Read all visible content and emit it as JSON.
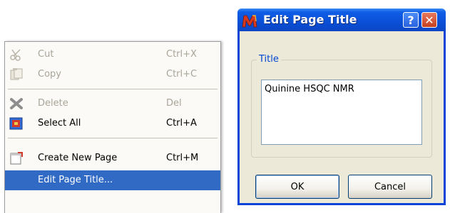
{
  "menu": {
    "items": [
      {
        "label": "Cut",
        "shortcut": "Ctrl+X",
        "icon": "scissors-icon",
        "enabled": false
      },
      {
        "label": "Copy",
        "shortcut": "Ctrl+C",
        "icon": "copy-icon",
        "enabled": false
      },
      {
        "label": "Delete",
        "shortcut": "Del",
        "icon": "delete-x-icon",
        "enabled": false
      },
      {
        "label": "Select All",
        "shortcut": "Ctrl+A",
        "icon": "select-all-icon",
        "enabled": true
      },
      {
        "label": "Create New Page",
        "shortcut": "Ctrl+M",
        "icon": "new-page-icon",
        "enabled": true
      },
      {
        "label": "Edit Page Title...",
        "shortcut": "",
        "icon": "",
        "enabled": true,
        "highlighted": true
      }
    ]
  },
  "dialog": {
    "title": "Edit Page Title",
    "help_label": "?",
    "close_label": "✕",
    "group_label": "Title",
    "title_value": "Quinine HSQC NMR",
    "ok_label": "OK",
    "cancel_label": "Cancel"
  },
  "colors": {
    "titlebar": "#0a4fd6",
    "highlight": "#316ac5",
    "group_label": "#0046d5"
  }
}
